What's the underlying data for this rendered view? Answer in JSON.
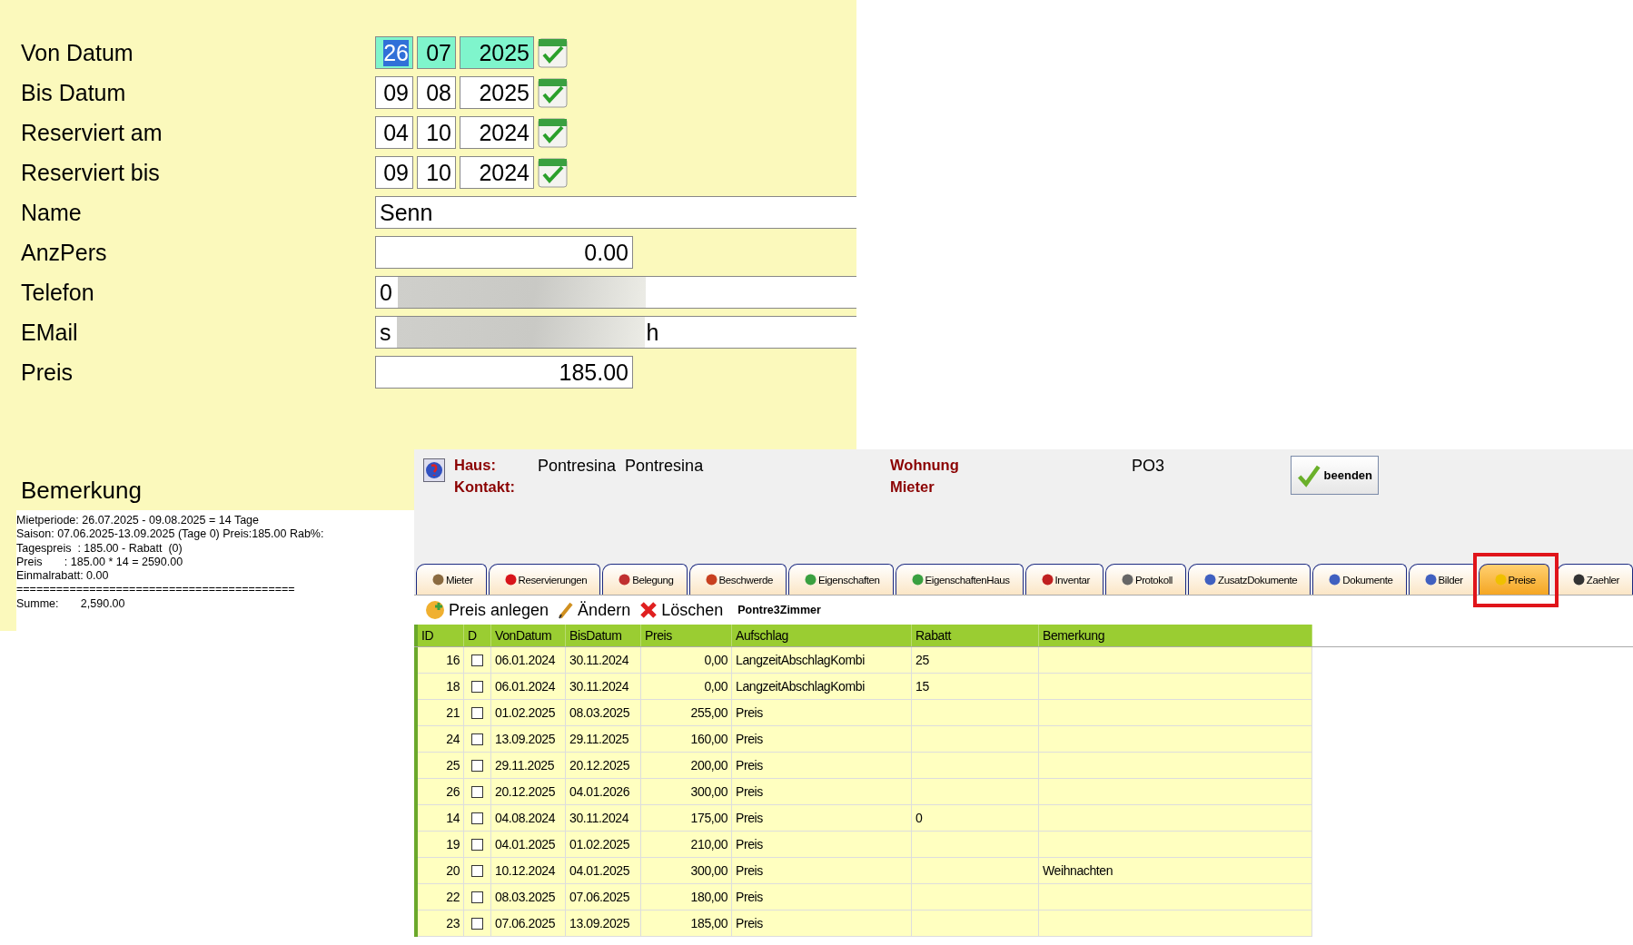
{
  "form": {
    "rows": [
      {
        "kind": "date",
        "label": "Von Datum",
        "day": "26",
        "month": "07",
        "year": "2025",
        "focused": true
      },
      {
        "kind": "date",
        "label": "Bis Datum",
        "day": "09",
        "month": "08",
        "year": "2025",
        "focused": false
      },
      {
        "kind": "date",
        "label": "Reserviert am",
        "day": "04",
        "month": "10",
        "year": "2024",
        "focused": false
      },
      {
        "kind": "date",
        "label": "Reserviert bis",
        "day": "09",
        "month": "10",
        "year": "2024",
        "focused": false
      },
      {
        "kind": "text",
        "label": "Name",
        "value": "Senn"
      },
      {
        "kind": "number",
        "label": "AnzPers",
        "value": "0.00"
      },
      {
        "kind": "redacted",
        "label": "Telefon",
        "value_start": "0"
      },
      {
        "kind": "redacted",
        "label": "EMail",
        "value_start": "s",
        "value_end": "h"
      },
      {
        "kind": "number",
        "label": "Preis",
        "value": "185.00"
      }
    ]
  },
  "remark": {
    "label": "Bemerkung",
    "lines": [
      "Mietperiode: 26.07.2025 - 09.08.2025 = 14 Tage",
      "Saison: 07.06.2025-13.09.2025 (Tage 0) Preis:185.00 Rab%:",
      "Tagespreis  : 185.00 - Rabatt  (0)",
      "Preis       : 185.00 * 14 = 2590.00",
      "Einmalrabatt: 0.00",
      "==========================================",
      "Summe:       2,590.00"
    ]
  },
  "header": {
    "haus_label": "Haus:",
    "haus_value": "Pontresina  Pontresina",
    "kontakt_label": "Kontakt:",
    "wohnung_label": "Wohnung",
    "wohnung_value": "PO3",
    "mieter_label": "Mieter",
    "close_button": "beenden"
  },
  "tabs": [
    {
      "label": "Mieter",
      "selected": false
    },
    {
      "label": "Reservierungen",
      "selected": false
    },
    {
      "label": "Belegung",
      "selected": false
    },
    {
      "label": "Beschwerde",
      "selected": false
    },
    {
      "label": "Eigenschaften",
      "selected": false
    },
    {
      "label": "EigenschaftenHaus",
      "selected": false
    },
    {
      "label": "Inventar",
      "selected": false
    },
    {
      "label": "Protokoll",
      "selected": false
    },
    {
      "label": "ZusatzDokumente",
      "selected": false
    },
    {
      "label": "Dokumente",
      "selected": false
    },
    {
      "label": "Bilder",
      "selected": false
    },
    {
      "label": "Preise",
      "selected": true
    },
    {
      "label": "Zaehler",
      "selected": false
    }
  ],
  "toolbar": {
    "add": "Preis anlegen",
    "edit": "Ändern",
    "delete": "Löschen",
    "context": "Pontre3Zimmer"
  },
  "table": {
    "columns": [
      "ID",
      "D",
      "VonDatum",
      "BisDatum",
      "Preis",
      "Aufschlag",
      "Rabatt",
      "Bemerkung"
    ],
    "rows": [
      {
        "id": "16",
        "d": false,
        "von": "06.01.2024",
        "bis": "30.11.2024",
        "preis": "0,00",
        "aufschlag": "LangzeitAbschlagKombi",
        "rabatt": "25",
        "bemerkung": ""
      },
      {
        "id": "18",
        "d": false,
        "von": "06.01.2024",
        "bis": "30.11.2024",
        "preis": "0,00",
        "aufschlag": "LangzeitAbschlagKombi",
        "rabatt": "15",
        "bemerkung": ""
      },
      {
        "id": "21",
        "d": false,
        "von": "01.02.2025",
        "bis": "08.03.2025",
        "preis": "255,00",
        "aufschlag": "Preis",
        "rabatt": "",
        "bemerkung": ""
      },
      {
        "id": "24",
        "d": false,
        "von": "13.09.2025",
        "bis": "29.11.2025",
        "preis": "160,00",
        "aufschlag": "Preis",
        "rabatt": "",
        "bemerkung": ""
      },
      {
        "id": "25",
        "d": false,
        "von": "29.11.2025",
        "bis": "20.12.2025",
        "preis": "200,00",
        "aufschlag": "Preis",
        "rabatt": "",
        "bemerkung": ""
      },
      {
        "id": "26",
        "d": false,
        "von": "20.12.2025",
        "bis": "04.01.2026",
        "preis": "300,00",
        "aufschlag": "Preis",
        "rabatt": "",
        "bemerkung": ""
      },
      {
        "id": "14",
        "d": false,
        "von": "04.08.2024",
        "bis": "30.11.2024",
        "preis": "175,00",
        "aufschlag": "Preis",
        "rabatt": "0",
        "bemerkung": ""
      },
      {
        "id": "19",
        "d": false,
        "von": "04.01.2025",
        "bis": "01.02.2025",
        "preis": "210,00",
        "aufschlag": "Preis",
        "rabatt": "",
        "bemerkung": ""
      },
      {
        "id": "20",
        "d": false,
        "von": "10.12.2024",
        "bis": "04.01.2025",
        "preis": "300,00",
        "aufschlag": "Preis",
        "rabatt": "",
        "bemerkung": "Weihnachten"
      },
      {
        "id": "22",
        "d": false,
        "von": "08.03.2025",
        "bis": "07.06.2025",
        "preis": "180,00",
        "aufschlag": "Preis",
        "rabatt": "",
        "bemerkung": ""
      },
      {
        "id": "23",
        "d": false,
        "von": "07.06.2025",
        "bis": "13.09.2025",
        "preis": "185,00",
        "aufschlag": "Preis",
        "rabatt": "",
        "bemerkung": ""
      }
    ]
  }
}
